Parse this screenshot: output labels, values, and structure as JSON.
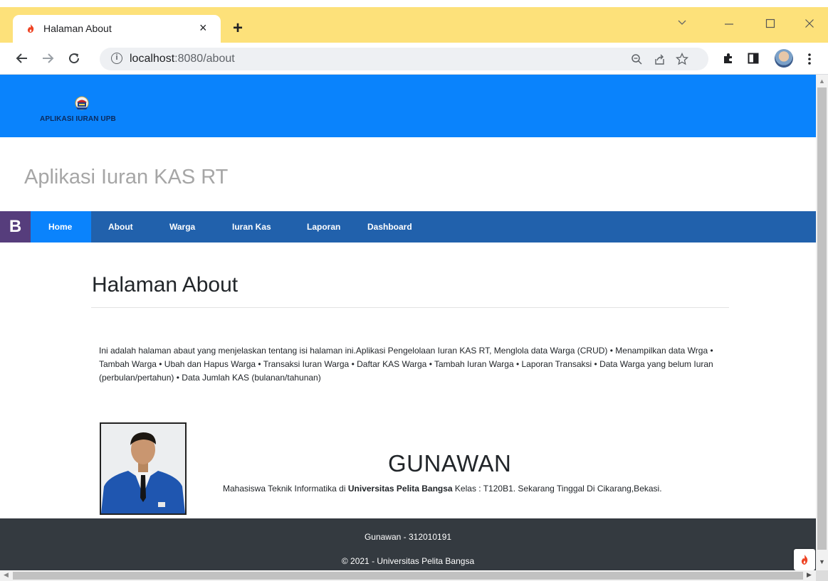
{
  "browser": {
    "tab_title": "Halaman About",
    "new_tab_glyph": "+",
    "tab_close_glyph": "×",
    "url_host": "localhost",
    "url_path": ":8080/about",
    "colors": {
      "tab_strip": "#fde17a"
    },
    "icons": [
      "back-arrow-icon",
      "forward-arrow-icon",
      "reload-icon",
      "info-icon",
      "zoom-icon",
      "share-icon",
      "bookmark-star-icon",
      "extensions-puzzle-icon",
      "side-panel-icon",
      "profile-avatar",
      "menu-kebab-icon",
      "minimize-icon",
      "maximize-icon",
      "close-window-icon",
      "tab-search-chevron-icon"
    ]
  },
  "page": {
    "logo_text": "APLIKASI IURAN UPB",
    "app_title": "Aplikasi Iuran KAS RT",
    "brand_letter": "B",
    "nav": [
      {
        "label": "Home",
        "active": true
      },
      {
        "label": "About",
        "active": false
      },
      {
        "label": "Warga",
        "active": false
      },
      {
        "label": "Iuran Kas",
        "active": false
      },
      {
        "label": "Laporan",
        "active": false
      },
      {
        "label": "Dashboard",
        "active": false
      }
    ],
    "content_title": "Halaman About",
    "content_paragraph": "Ini adalah halaman abaut yang menjelaskan tentang isi halaman ini.Aplikasi Pengelolaan Iuran KAS RT, Menglola data Warga (CRUD) • Menampilkan data Wrga • Tambah Warga • Ubah dan Hapus Warga • Transaksi Iuran Warga • Daftar KAS Warga • Tambah Iuran Warga • Laporan Transaksi • Data Warga yang belum Iuran (perbulan/pertahun) • Data Jumlah KAS (bulanan/tahunan)",
    "profile": {
      "name": "GUNAWAN",
      "desc_prefix": "Mahasiswa Teknik Informatika di ",
      "desc_bold": "Universitas Pelita Bangsa",
      "desc_suffix": " Kelas : T120B1. Sekarang Tinggal Di Cikarang,Bekasi."
    },
    "footer_line1": "Gunawan - 312010191",
    "footer_line2": "© 2021 - Universitas Pelita Bangsa",
    "colors": {
      "hero": "#0a83fc",
      "navbar": "#2161ac",
      "nav_active": "#0a83fc",
      "brand": "#563d7c",
      "footer": "#343a40",
      "title": "#a6a6a6"
    }
  }
}
